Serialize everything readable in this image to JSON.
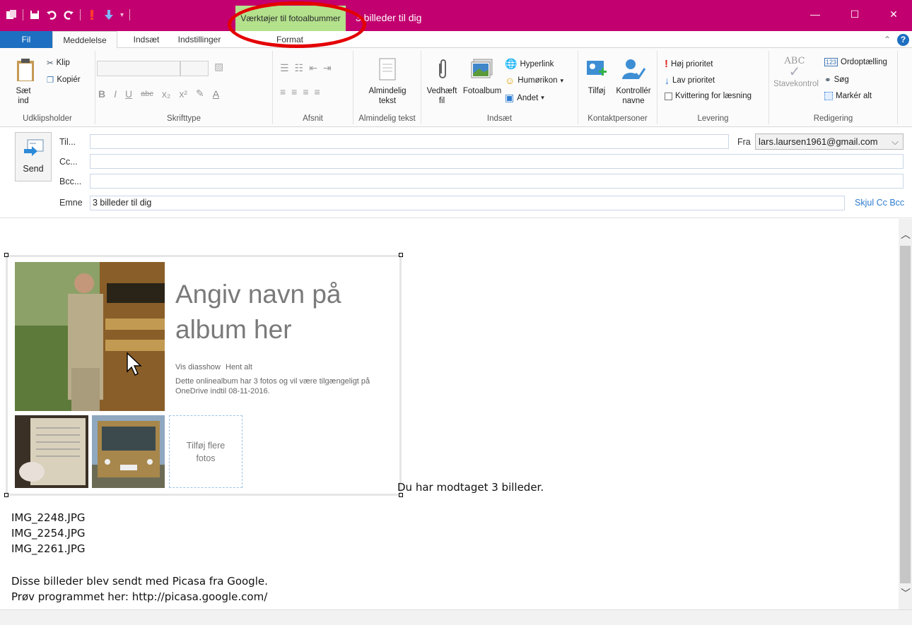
{
  "titlebar": {
    "context_tab": "Værktøjer til fotoalbummer",
    "title": "3 billeder til dig",
    "min": "—",
    "max": "☐",
    "close": "✕"
  },
  "tabs": {
    "fil": "Fil",
    "meddelelse": "Meddelelse",
    "indsaet": "Indsæt",
    "indstillinger": "Indstillinger",
    "format": "Format"
  },
  "ribbon": {
    "clipboard": {
      "paste": "Sæt ind",
      "cut": "Klip",
      "copy": "Kopiér",
      "label": "Udklipsholder"
    },
    "font": {
      "label": "Skrifttype"
    },
    "paragraph": {
      "label": "Afsnit"
    },
    "plaintext": {
      "button": "Almindelig tekst",
      "label": "Almindelig tekst"
    },
    "insert": {
      "attach": "Vedhæft fil",
      "photoalbum": "Fotoalbum",
      "hyperlink": "Hyperlink",
      "emoticon": "Humørikon",
      "other": "Andet",
      "label": "Indsæt"
    },
    "contacts": {
      "add": "Tilføj",
      "check": "Kontrollér navne",
      "label": "Kontaktpersoner"
    },
    "delivery": {
      "high": "Høj prioritet",
      "low": "Lav prioritet",
      "receipt": "Kvittering for læsning",
      "label": "Levering"
    },
    "editing": {
      "spell": "Stavekontrol",
      "wordcount": "Ordoptælling",
      "find": "Søg",
      "selectall": "Markér alt",
      "label": "Redigering"
    }
  },
  "header": {
    "send": "Send",
    "to": "Til...",
    "cc": "Cc...",
    "bcc": "Bcc...",
    "from_label": "Fra",
    "from_value": "lars.laursen1961@gmail.com",
    "subject_label": "Emne",
    "subject_value": "3 billeder til dig",
    "hide_cc": "Skjul Cc Bcc"
  },
  "album": {
    "title": "Angiv navn på album her",
    "slideshow": "Vis diasshow",
    "download": "Hent alt",
    "description": "Dette onlinealbum har 3 fotos og vil være tilgængeligt på OneDrive indtil 08-11-2016.",
    "add_more": "Tilføj flere fotos"
  },
  "body": {
    "received": "Du har modtaget 3 billeder.",
    "files": [
      "IMG_2248.JPG",
      "IMG_2254.JPG",
      "IMG_2261.JPG"
    ],
    "sent_with": "Disse billeder blev sendt med Picasa fra Google.",
    "try_it": "Prøv programmet her: http://picasa.google.com/"
  },
  "colors": {
    "titlebar": "#c2006f",
    "context_tab": "#b3e18c",
    "fil_tab": "#1e6fc1",
    "annotation_ring": "#e40000"
  }
}
